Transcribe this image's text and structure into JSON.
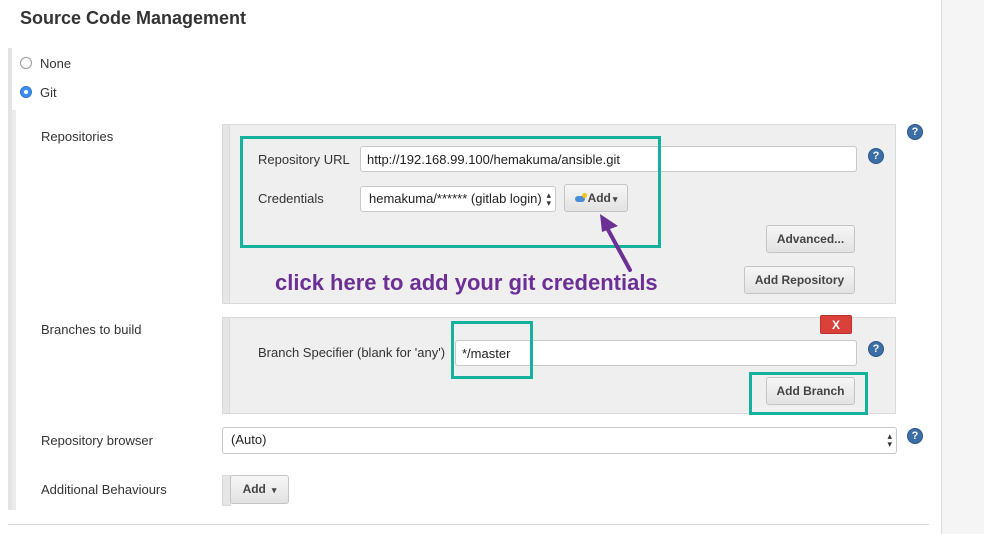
{
  "section_title": "Source Code Management",
  "scm_options": [
    {
      "label": "None",
      "selected": false
    },
    {
      "label": "Git",
      "selected": true
    }
  ],
  "repositories": {
    "label": "Repositories",
    "url_label": "Repository URL",
    "url_value": "http://192.168.99.100/hemakuma/ansible.git",
    "credentials_label": "Credentials",
    "credentials_value": "hemakuma/****** (gitlab login)",
    "add_button": "Add",
    "advanced_button": "Advanced...",
    "add_repository_button": "Add Repository"
  },
  "annotation": "click here to add your git credentials",
  "branches": {
    "label": "Branches to build",
    "delete_button": "X",
    "specifier_label": "Branch Specifier (blank for 'any')",
    "specifier_value": "*/master",
    "add_branch_button": "Add Branch"
  },
  "repository_browser": {
    "label": "Repository browser",
    "value": "(Auto)"
  },
  "additional_behaviours": {
    "label": "Additional Behaviours",
    "add_button": "Add"
  },
  "colors": {
    "highlight": "#14b29c",
    "annotation": "#6b2f96",
    "delete": "#d9413a",
    "selected_radio": "#3a8ef0"
  }
}
